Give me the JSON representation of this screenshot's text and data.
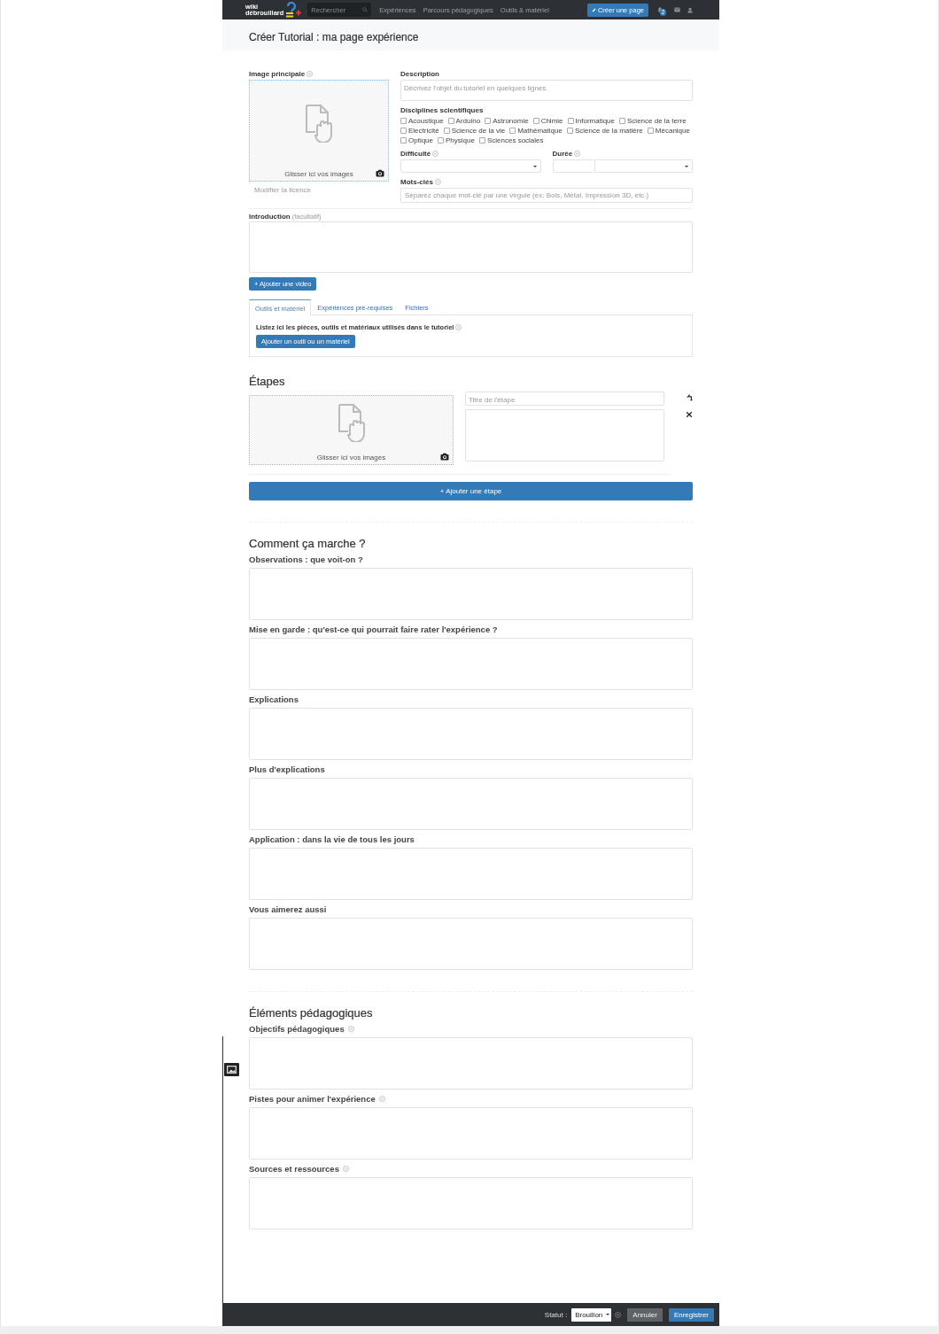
{
  "nav": {
    "logo_text": [
      "wiki",
      "débrouillard"
    ],
    "search_placeholder": "Rechercher",
    "links": [
      "Expériences",
      "Parcours pédagogiques",
      "Outils & matériel"
    ],
    "create_button": "Créer une page",
    "notification_count": "2"
  },
  "page_title": "Créer Tutorial : ma page expérience",
  "main_image": {
    "label": "Image principale",
    "drop_text": "Glisser ici vos images",
    "license_link": "Modifier la licence"
  },
  "description": {
    "label": "Description",
    "placeholder": "Décrivez l'objet du tutoriel en quelques lignes."
  },
  "disciplines": {
    "label": "Disciplines scientifiques",
    "options": [
      {
        "label": "Acoustique",
        "checked": false
      },
      {
        "label": "Arduino",
        "checked": false
      },
      {
        "label": "Astronomie",
        "checked": false
      },
      {
        "label": "Chimie",
        "checked": false
      },
      {
        "label": "Informatique",
        "checked": false
      },
      {
        "label": "Science de la terre",
        "checked": false
      },
      {
        "label": "Electricité",
        "checked": false
      },
      {
        "label": "Science de la vie",
        "checked": false
      },
      {
        "label": "Mathématique",
        "checked": false
      },
      {
        "label": "Science de la matière",
        "checked": false
      },
      {
        "label": "Mécanique",
        "checked": false
      },
      {
        "label": "Optique",
        "checked": false
      },
      {
        "label": "Physique",
        "checked": false
      },
      {
        "label": "Sciences sociales",
        "checked": false
      }
    ]
  },
  "difficulty": {
    "label": "Difficulté"
  },
  "duration": {
    "label": "Durée"
  },
  "keywords": {
    "label": "Mots-clés",
    "placeholder": "Séparez chaque mot-clé par une virgule (ex: Bois, Métal, Impression 3D, etc.)"
  },
  "introduction": {
    "label": "Introduction",
    "hint": "(facultatif)"
  },
  "add_video_button": "+ Ajouter une video",
  "tabs": [
    {
      "label": "Outils et matériel",
      "selected": true
    },
    {
      "label": "Expériences pré-requises",
      "selected": false
    },
    {
      "label": "Fichiers",
      "selected": false
    }
  ],
  "tab_panel": {
    "text": "Listez ici les pièces, outils et matériaux utilisés dans le tutoriel",
    "button": "Ajouter un outil ou un matériel"
  },
  "steps": {
    "heading": "Étapes",
    "items": [
      {
        "drop_text": "Glisser ici vos images",
        "title_placeholder": "Titre de l'étape"
      }
    ],
    "add_button": "+ Ajouter une étape"
  },
  "sections": [
    {
      "heading": "Comment ça marche ?",
      "fields": [
        {
          "label": "Observations : que voit-on ?",
          "help": false
        },
        {
          "label": "Mise en garde : qu'est-ce qui pourrait faire rater l'expérience ?",
          "help": false
        },
        {
          "label": "Explications",
          "help": false
        },
        {
          "label": "Plus d'explications",
          "help": false
        },
        {
          "label": "Application : dans la vie de tous les jours",
          "help": false
        },
        {
          "label": "Vous aimerez aussi",
          "help": false
        }
      ]
    },
    {
      "heading": "Éléments pédagogiques",
      "fields": [
        {
          "label": "Objectifs pédagogiques",
          "help": true
        },
        {
          "label": "Pistes pour animer l'expérience",
          "help": true
        },
        {
          "label": "Sources et ressources",
          "help": true
        }
      ]
    }
  ],
  "footer": {
    "status_label": "Statut :",
    "status_value": "Brouillon",
    "cancel_button": "Annuler",
    "save_button": "Enregistrer"
  }
}
